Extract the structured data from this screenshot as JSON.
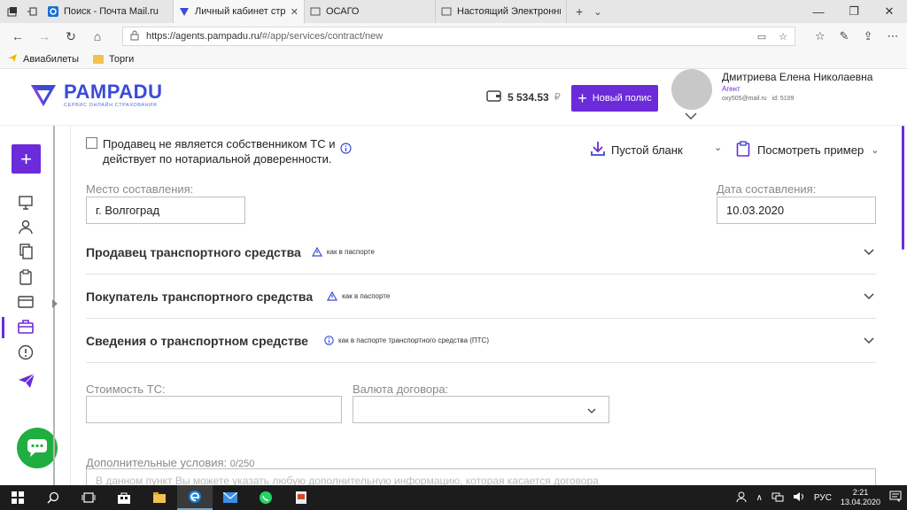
{
  "browser": {
    "tabs": [
      {
        "title": "Поиск - Почта Mail.ru",
        "active": false
      },
      {
        "title": "Личный кабинет страх",
        "active": true
      },
      {
        "title": "ОСАГО",
        "active": false
      },
      {
        "title": "Настоящий Электронный П",
        "active": false
      }
    ],
    "url_host": "https://agents.pampadu.ru/",
    "url_path": "#/app/services/contract/new",
    "bookmarks": [
      "Авиабилеты",
      "Торги"
    ]
  },
  "header": {
    "logo_name": "PAMPADU",
    "logo_tagline": "СЕРВИС ОНЛАЙН СТРАХОВАНИЯ",
    "balance": "5 534.53",
    "currency": "₽",
    "new_policy_label": "Новый полис",
    "user_name": "Дмитриева Елена Николаевна",
    "user_role": "Агент",
    "user_email": "oxy505@mail.ru",
    "user_id": "id: 5109"
  },
  "form": {
    "checkbox_label": "Продавец не является собственником ТС и действует по нотариальной доверенности.",
    "blank_button": "Пустой бланк",
    "example_button": "Посмотреть пример",
    "place_label": "Место составления:",
    "place_value": "г. Волгоград",
    "date_label": "Дата составления:",
    "date_value": "10.03.2020",
    "sections": [
      {
        "title": "Продавец транспортного средства",
        "hint": "как в паспорте",
        "hint_icon": "warning-icon"
      },
      {
        "title": "Покупатель транспортного средства",
        "hint": "как в паспорте",
        "hint_icon": "warning-icon"
      },
      {
        "title": "Сведения о транспортном средстве",
        "hint": "как в паспорте транспортного средства (ПТС)",
        "hint_icon": "info-icon"
      }
    ],
    "cost_label": "Стоимость ТС:",
    "cost_value": "",
    "currency_label": "Валюта договора:",
    "currency_value": "",
    "extra_label": "Дополнительные условия:",
    "extra_counter": "0/250",
    "extra_placeholder": "В данном пункт Вы можете указать любую дополнительную информацию, которая касается договора"
  },
  "taskbar": {
    "lang": "РУС",
    "time": "2:21",
    "date": "13.04.2020"
  },
  "colors": {
    "accent": "#6b2bd9",
    "brand_blue": "#3a4bd8",
    "chat_green": "#1fae3f"
  }
}
